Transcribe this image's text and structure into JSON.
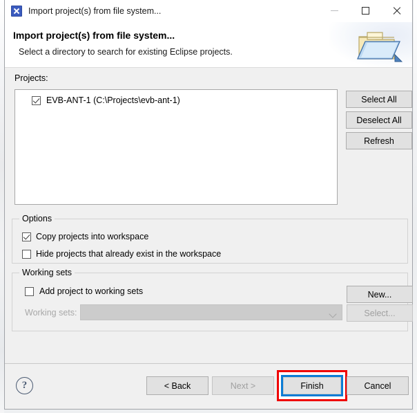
{
  "window": {
    "title": "Import project(s) from file system...",
    "icon": "eclipse-wizard-icon",
    "controls": {
      "minimize": "minimize-icon",
      "maximize": "maximize-icon",
      "close": "close-icon"
    }
  },
  "banner": {
    "title": "Import project(s) from file system...",
    "subtitle": "Select a directory to search for existing Eclipse projects.",
    "icon": "open-folder-import-icon"
  },
  "projects": {
    "label": "Projects:",
    "items": [
      {
        "name": "EVB-ANT-1 (C:\\Projects\\evb-ant-1)",
        "checked": true
      }
    ],
    "buttons": {
      "select_all": "Select All",
      "deselect_all": "Deselect All",
      "refresh": "Refresh"
    }
  },
  "options": {
    "title": "Options",
    "items": [
      {
        "label": "Copy projects into workspace",
        "checked": true
      },
      {
        "label": "Hide projects that already exist in the workspace",
        "checked": false
      }
    ]
  },
  "working_sets": {
    "title": "Working sets",
    "add_checkbox": {
      "label": "Add project to working sets",
      "checked": false
    },
    "combo_label": "Working sets:",
    "combo_value": "",
    "combo_enabled": false,
    "new_button": "New...",
    "select_button": "Select...",
    "select_enabled": false
  },
  "footer": {
    "help": "?",
    "back": "< Back",
    "next": "Next >",
    "next_enabled": false,
    "finish": "Finish",
    "cancel": "Cancel",
    "highlight_color": "#ef0000",
    "focus_color": "#0c7cd5"
  }
}
